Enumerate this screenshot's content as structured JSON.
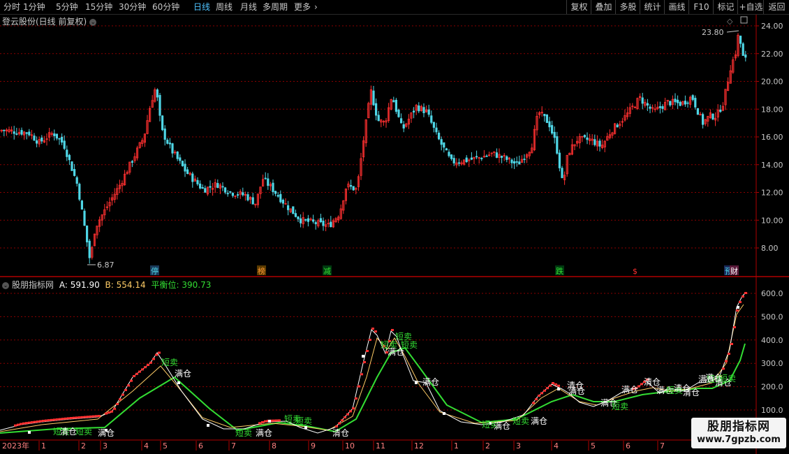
{
  "toolbar": {
    "periods": [
      "分时",
      "1分钟",
      "5分钟",
      "15分钟",
      "30分钟",
      "60分钟",
      "日线",
      "周线",
      "月线",
      "多周期",
      "更多"
    ],
    "active": "日线",
    "right_buttons": [
      "复权",
      "叠加",
      "多股",
      "统计",
      "画线",
      "F10",
      "标记",
      "+自选",
      "返回"
    ]
  },
  "main_title": "登云股份(日线 前复权)",
  "indicator": {
    "name": "股朋指标网",
    "a_label": "A:",
    "a_value": "591.90",
    "b_label": "B:",
    "b_value": "554.14",
    "balance_label": "平衡位:",
    "balance_value": "390.73"
  },
  "price_axis": [
    "24.00",
    "22.00",
    "20.00",
    "18.00",
    "16.00",
    "14.00",
    "12.00",
    "10.00",
    "8.00"
  ],
  "ind_axis": [
    "600.0",
    "500.0",
    "400.0",
    "300.0",
    "200.0",
    "100.0"
  ],
  "max_label": "23.80",
  "min_label": "6.87",
  "time_axis": {
    "year": "2023年",
    "months": [
      "1",
      "2",
      "3",
      "4",
      "5",
      "6",
      "7",
      "8",
      "9",
      "10",
      "11",
      "12",
      "1",
      "2",
      "3",
      "4",
      "5",
      "6",
      "7"
    ]
  },
  "event_tags": [
    "停",
    "榜",
    "减",
    "跌",
    "$",
    "预",
    "财"
  ],
  "signals": [
    "短卖",
    "清仓",
    "短卖",
    "满仓",
    "短卖",
    "满仓",
    "短卖",
    "满仓",
    "短卖",
    "短卖",
    "清仓",
    "短卖",
    "满仓",
    "短卖",
    "短卖",
    "满仓",
    "短卖",
    "满仓",
    "短卖",
    "满仓",
    "清仓",
    "满仓",
    "满仓",
    "短卖",
    "清仓",
    "满仓",
    "短卖",
    "清仓",
    "满仓",
    "短卖",
    "清仓",
    "短卖",
    "满仓",
    "清仓",
    "满仓"
  ],
  "watermark": {
    "line1": "股朋指标网",
    "line2": "www.7gpzb.com"
  },
  "colors": {
    "up": "#ff3030",
    "down": "#4fd6e6",
    "line_a": "#ffffff",
    "line_b": "#ffcc66",
    "balance": "#33dd33",
    "grid": "#8b0000",
    "frame": "#b00000"
  },
  "chart_data": {
    "type": "candlestick",
    "title": "登云股份(日线 前复权)",
    "ylim_price": [
      7,
      24.6
    ],
    "ylim_indicator": [
      0,
      620
    ],
    "price_key_points": [
      {
        "x": "2023-01",
        "close": 16.5
      },
      {
        "x": "2023-02",
        "close": 15.8
      },
      {
        "x": "2023-03",
        "close": 6.87
      },
      {
        "x": "2023-04",
        "close": 13.0
      },
      {
        "x": "2023-05",
        "close": 19.5
      },
      {
        "x": "2023-06",
        "close": 14.0
      },
      {
        "x": "2023-07",
        "close": 12.5
      },
      {
        "x": "2023-08",
        "close": 11.5
      },
      {
        "x": "2023-09",
        "close": 9.4
      },
      {
        "x": "2023-10",
        "close": 12.5
      },
      {
        "x": "2023-11",
        "close": 19.5
      },
      {
        "x": "2023-12",
        "close": 17.5
      },
      {
        "x": "2024-01",
        "close": 14.0
      },
      {
        "x": "2024-02",
        "close": 14.0
      },
      {
        "x": "2024-03",
        "close": 14.0
      },
      {
        "x": "2024-04",
        "close": 16.0
      },
      {
        "x": "2024-05",
        "close": 16.0
      },
      {
        "x": "2024-06",
        "close": 18.5
      },
      {
        "x": "2024-07",
        "close": 18.5
      },
      {
        "x": "2024-08",
        "close": 23.8
      }
    ],
    "price_max": 23.8,
    "price_min": 6.87,
    "indicator_series": [
      {
        "name": "A",
        "last": 591.9
      },
      {
        "name": "B",
        "last": 554.14
      },
      {
        "name": "平衡位",
        "last": 390.73
      }
    ]
  }
}
